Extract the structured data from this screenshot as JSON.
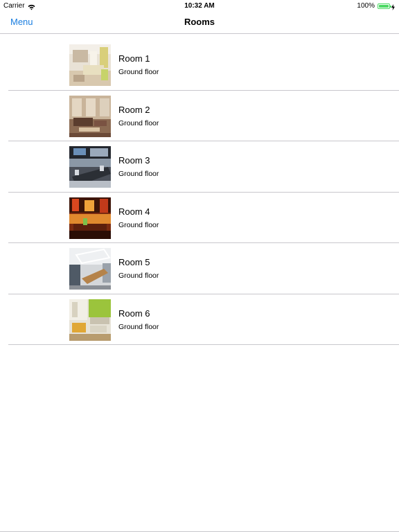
{
  "status_bar": {
    "carrier": "Carrier",
    "wifi_icon": "wifi-icon",
    "time": "10:32 AM",
    "battery_percent": "100%",
    "battery_level": 1.0,
    "battery_color": "#4cd964"
  },
  "nav": {
    "menu_label": "Menu",
    "title": "Rooms",
    "accent_color": "#1a7ee0"
  },
  "rooms": [
    {
      "name": "Room 1",
      "floor": "Ground floor",
      "thumb": "bright-bedroom-photo"
    },
    {
      "name": "Room 2",
      "floor": "Ground floor",
      "thumb": "living-room-photo"
    },
    {
      "name": "Room 3",
      "floor": "Ground floor",
      "thumb": "conference-room-photo"
    },
    {
      "name": "Room 4",
      "floor": "Ground floor",
      "thumb": "restaurant-photo"
    },
    {
      "name": "Room 5",
      "floor": "Ground floor",
      "thumb": "meeting-room-photo"
    },
    {
      "name": "Room 6",
      "floor": "Ground floor",
      "thumb": "green-wall-room-photo"
    }
  ]
}
